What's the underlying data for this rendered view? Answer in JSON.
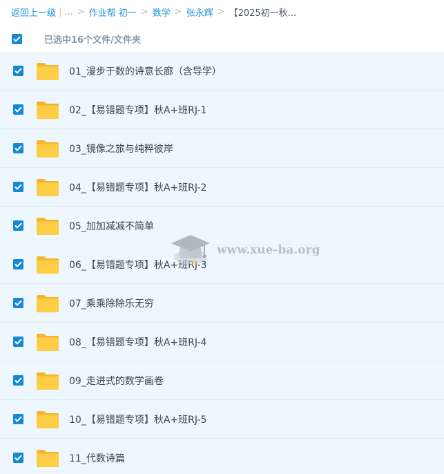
{
  "breadcrumb": {
    "back": "返回上一级",
    "pipe": "|",
    "ellipsis": "...",
    "sep": ">",
    "items": [
      "作业帮 初一",
      "数学",
      "张永辉"
    ],
    "current": "【2025初一秋..."
  },
  "selection": {
    "text": "已选中16个文件/文件夹"
  },
  "files": [
    {
      "name": "01_漫步于数的诗意长廊（含导学）"
    },
    {
      "name": "02_【易错题专项】秋A+班RJ-1"
    },
    {
      "name": "03_镜像之旅与纯粹彼岸"
    },
    {
      "name": "04_【易错题专项】秋A+班RJ-2"
    },
    {
      "name": "05_加加减减不简单"
    },
    {
      "name": "06_【易错题专项】秋A+班RJ-3"
    },
    {
      "name": "07_乘乘除除乐无穷"
    },
    {
      "name": "08_【易错题专项】秋A+班RJ-4"
    },
    {
      "name": "09_走进式的数学画卷"
    },
    {
      "name": "10_【易错题专项】秋A+班RJ-5"
    },
    {
      "name": "11_代数诗篇"
    }
  ],
  "watermark": {
    "text": "www.xue-ba.org",
    "icon": "graduation-cap-icon"
  },
  "colors": {
    "accent": "#1689d6",
    "row_bg": "#eef7fd",
    "folder": "#ffc83d",
    "link": "#1e91d9"
  }
}
